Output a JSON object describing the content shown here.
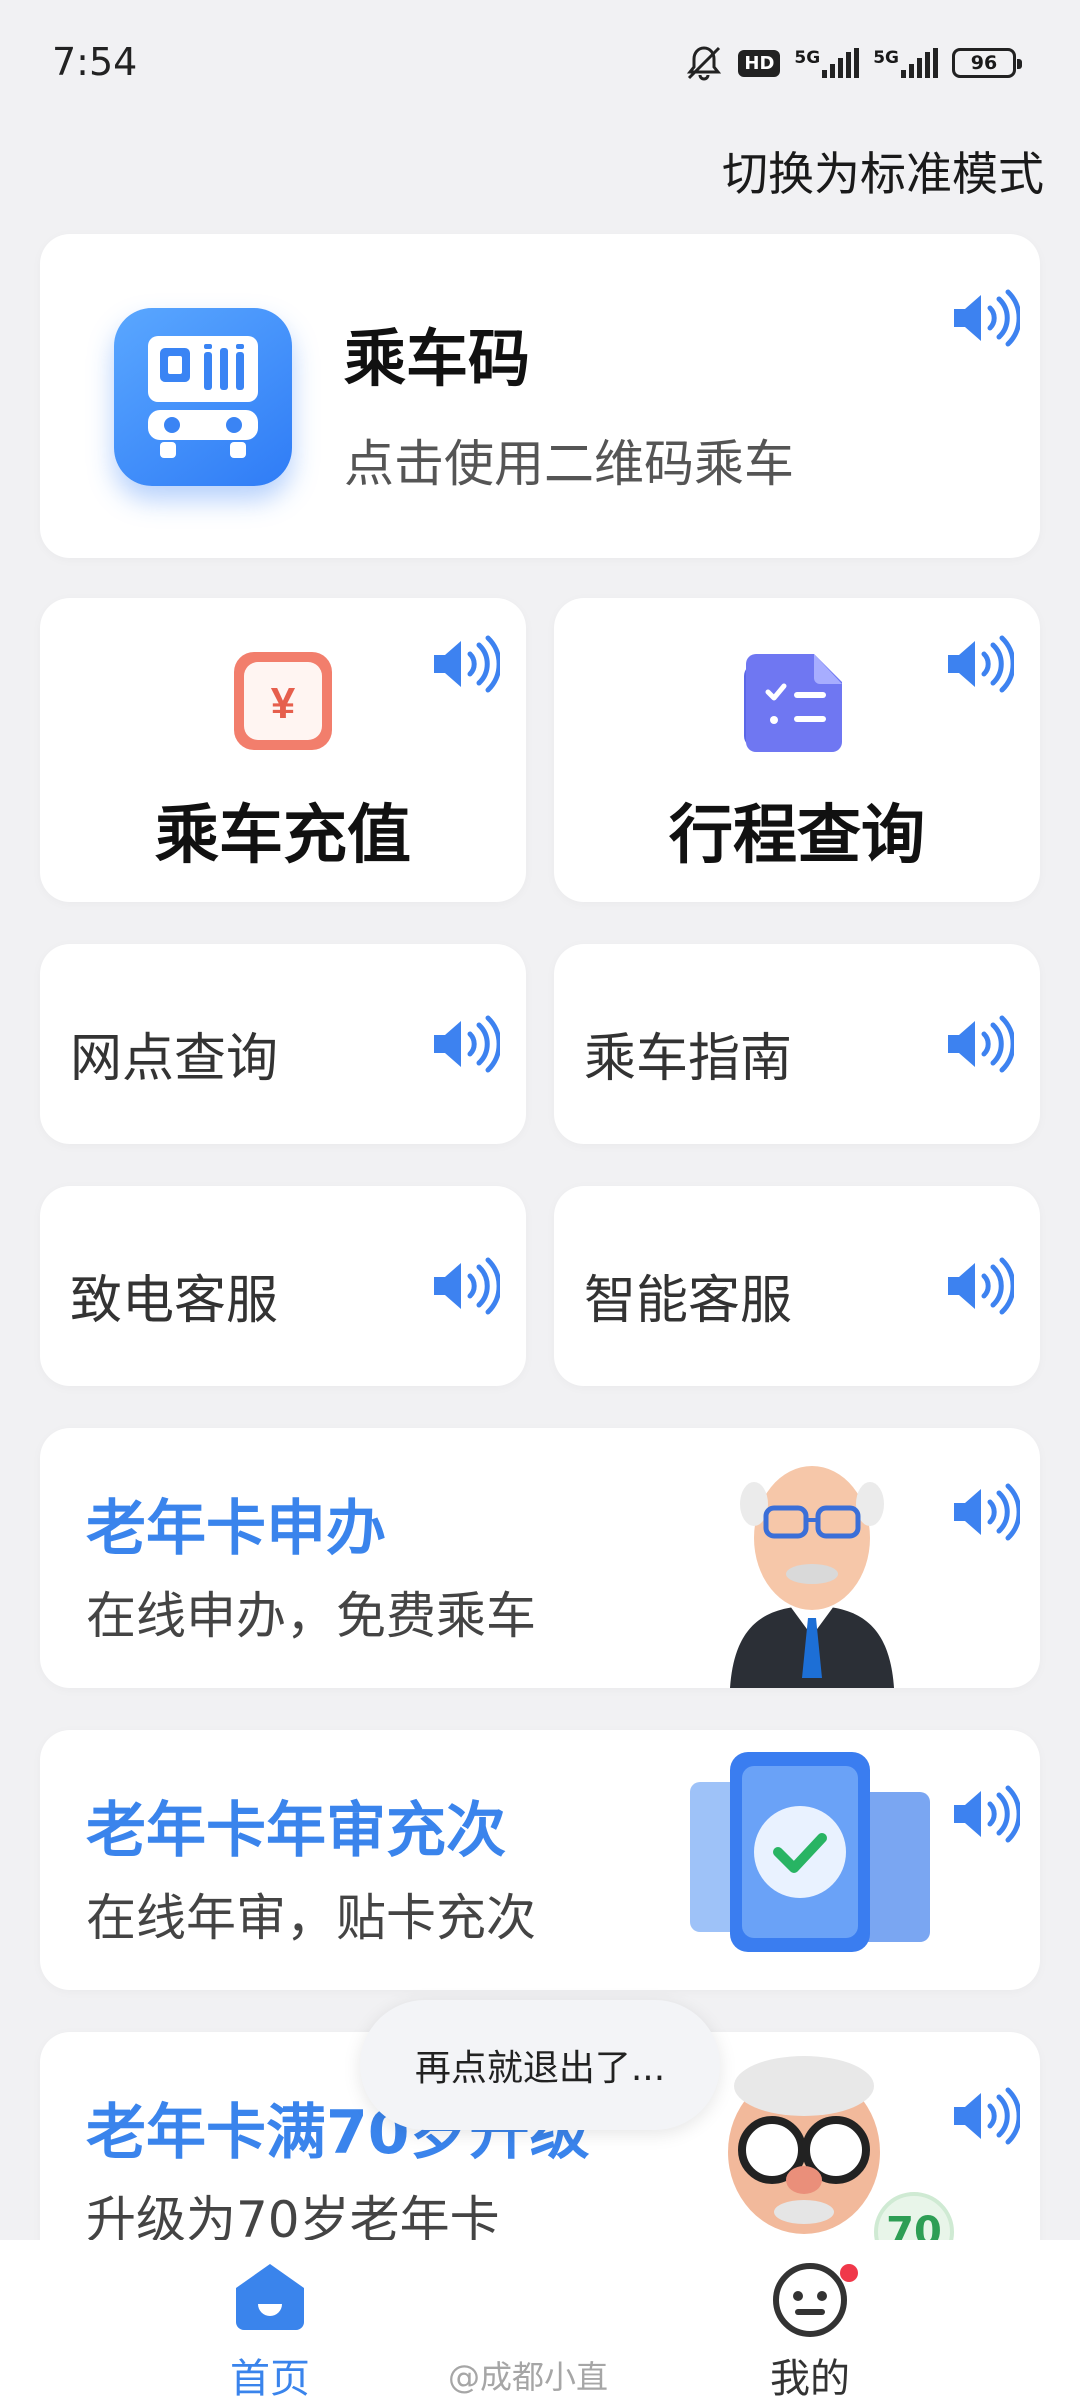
{
  "status_bar": {
    "time": "7:54",
    "hd_label": "HD",
    "signal_1": "5G",
    "signal_2": "5G",
    "battery": "96"
  },
  "header": {
    "mode_switch_label": "切换为标准模式"
  },
  "ride_code": {
    "title": "乘车码",
    "subtitle": "点击使用二维码乘车"
  },
  "features": [
    {
      "label": "乘车充值",
      "icon": "yuan-recharge-icon"
    },
    {
      "label": "行程查询",
      "icon": "trip-checklist-icon"
    }
  ],
  "services": [
    {
      "label": "网点查询"
    },
    {
      "label": "乘车指南"
    },
    {
      "label": "致电客服"
    },
    {
      "label": "智能客服"
    }
  ],
  "promos": [
    {
      "title": "老年卡申办",
      "subtitle": "在线申办，免费乘车"
    },
    {
      "title": "老年卡年审充次",
      "subtitle": "在线年审，贴卡充次"
    },
    {
      "title": "老年卡满70岁升级",
      "subtitle": "升级为70岁老年卡",
      "badge": "70"
    }
  ],
  "toast": {
    "text": "再点就退出了..."
  },
  "bottom_nav": {
    "home_label": "首页",
    "mine_label": "我的"
  },
  "watermark": {
    "text": "@成都小直"
  },
  "colors": {
    "accent": "#3a84ec",
    "speaker": "#3d82f0",
    "background": "#f1f1f3"
  }
}
